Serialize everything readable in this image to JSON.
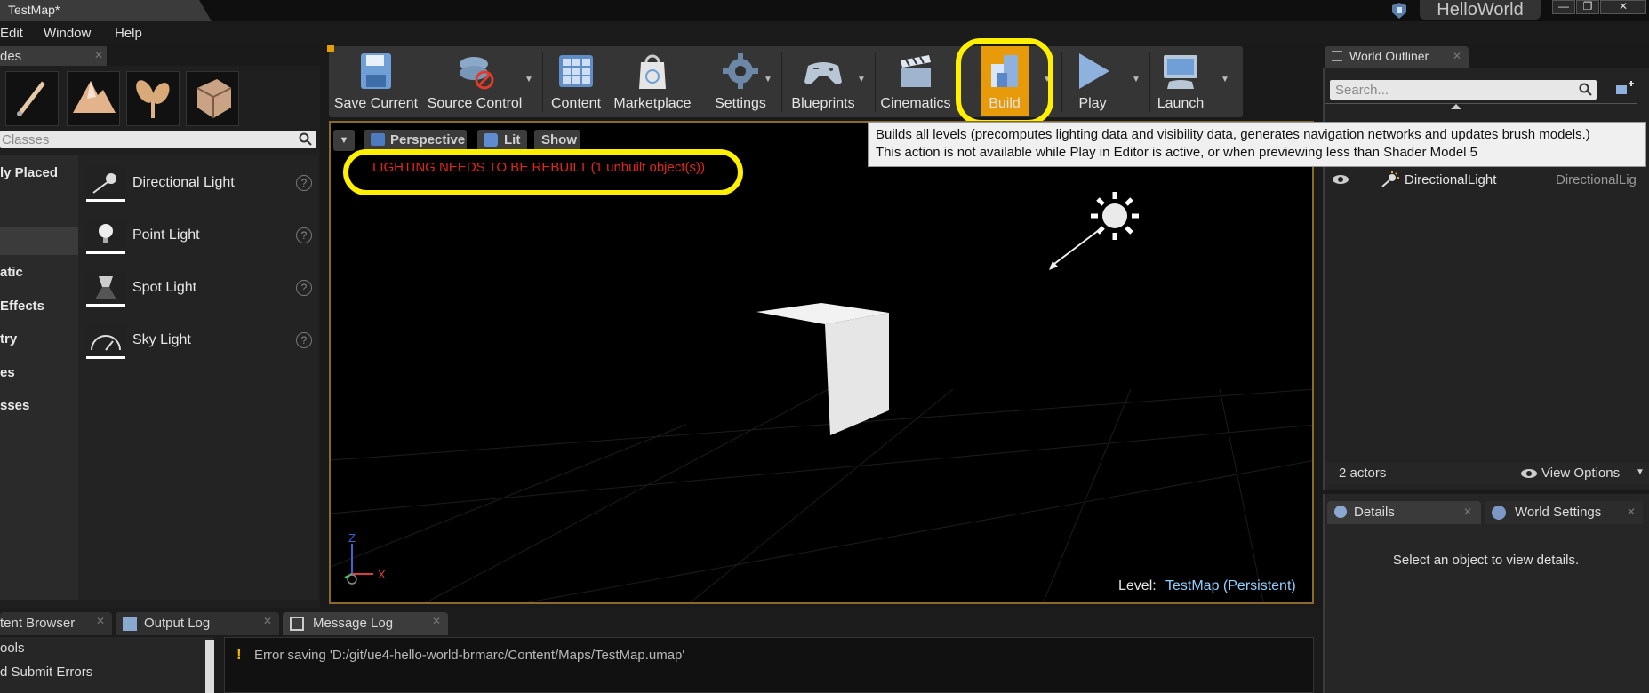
{
  "window": {
    "title": "TestMap*",
    "project": "HelloWorld",
    "controls": {
      "minimize": "—",
      "restore": "❐",
      "close": "✕"
    }
  },
  "menu": [
    "Edit",
    "Window",
    "Help"
  ],
  "modes": {
    "tab": "des",
    "search_placeholder": "Classes",
    "categories": [
      "ly Placed",
      "atic",
      "Effects",
      "try",
      "es",
      "sses"
    ],
    "items": [
      {
        "label": "Directional Light",
        "icon": "directional-light-icon"
      },
      {
        "label": "Point Light",
        "icon": "point-light-icon"
      },
      {
        "label": "Spot Light",
        "icon": "spot-light-icon"
      },
      {
        "label": "Sky Light",
        "icon": "sky-light-icon"
      }
    ],
    "help_glyph": "?"
  },
  "toolbar": {
    "buttons": [
      {
        "label": "Save Current",
        "icon": "save-icon"
      },
      {
        "label": "Source Control",
        "icon": "source-control-icon"
      },
      {
        "label": "Content",
        "icon": "content-icon"
      },
      {
        "label": "Marketplace",
        "icon": "marketplace-icon"
      },
      {
        "label": "Settings",
        "icon": "settings-icon"
      },
      {
        "label": "Blueprints",
        "icon": "blueprints-icon"
      },
      {
        "label": "Cinematics",
        "icon": "cinematics-icon"
      },
      {
        "label": "Build",
        "icon": "build-icon",
        "highlighted": true
      },
      {
        "label": "Play",
        "icon": "play-icon"
      },
      {
        "label": "Launch",
        "icon": "launch-icon"
      }
    ]
  },
  "tooltip": {
    "line1": "Builds all levels (precomputes lighting data and visibility data, generates navigation networks and updates brush models.)",
    "line2": "This action is not available while Play in Editor is active, or when previewing less than Shader Model 5"
  },
  "viewport": {
    "perspective": "Perspective",
    "lit": "Lit",
    "show": "Show",
    "warning": "LIGHTING NEEDS TO BE REBUILT (1 unbuilt object(s))",
    "level_label": "Level:",
    "level_name": "TestMap (Persistent)",
    "axis_z": "Z",
    "axis_x": "X"
  },
  "outliner": {
    "tab": "World Outliner",
    "search_placeholder": "Search...",
    "row": {
      "label": "DirectionalLight",
      "type": "DirectionalLig"
    },
    "actors": "2 actors",
    "view_options": "View Options"
  },
  "details": {
    "tab": "Details",
    "world_settings_tab": "World Settings",
    "empty": "Select an object to view details."
  },
  "bottom": {
    "tabs": [
      "tent Browser",
      "Output Log",
      "Message Log"
    ],
    "list": [
      "ools",
      "d Submit Errors"
    ],
    "message": "Error saving 'D:/git/ue4-hello-world-brmarc/Content/Maps/TestMap.umap'",
    "bang": "!"
  },
  "colors": {
    "accent": "#e89b0a",
    "highlight": "#ffef00",
    "warning": "#e0261d",
    "level": "#8fd0ff"
  }
}
